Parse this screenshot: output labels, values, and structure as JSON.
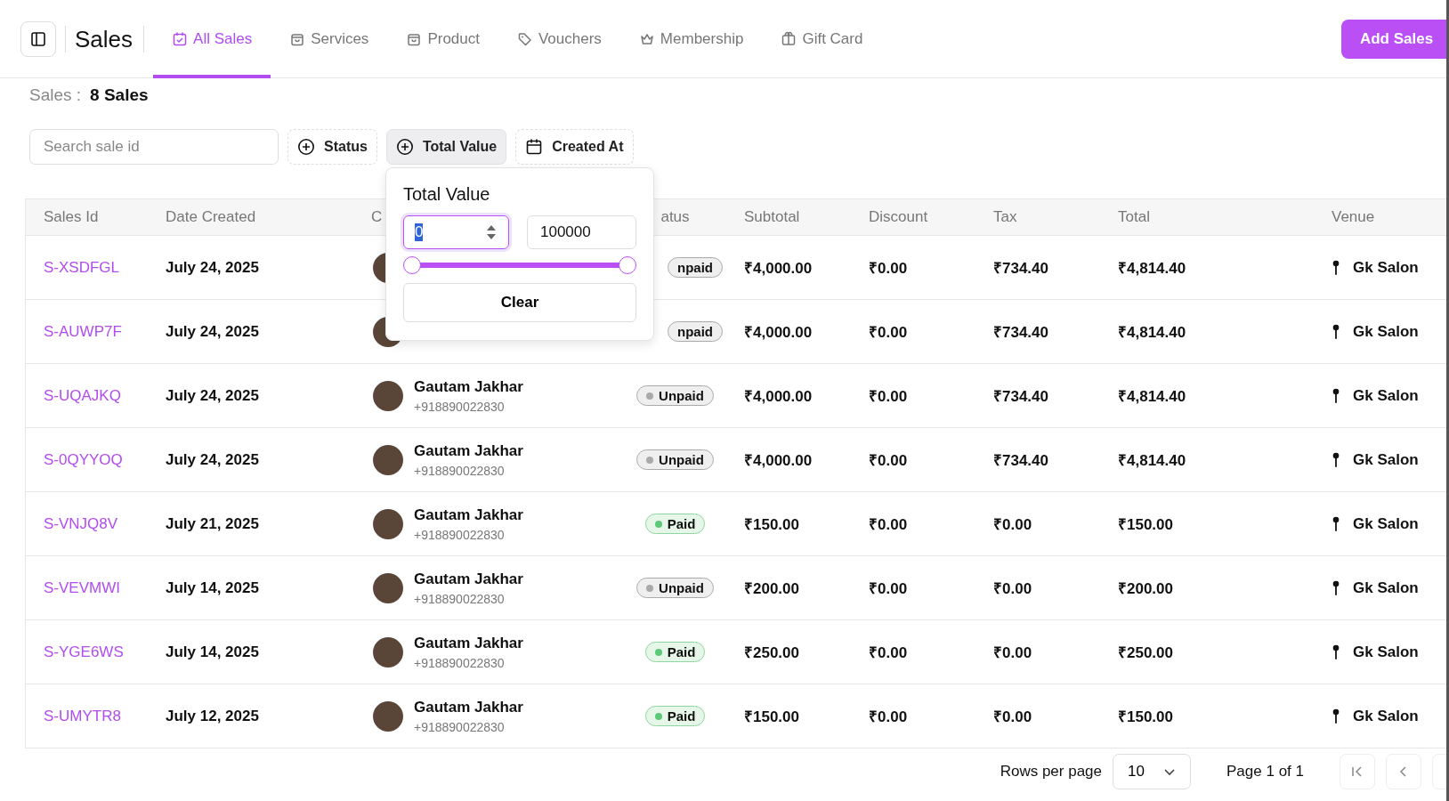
{
  "header": {
    "title": "Sales",
    "add_button": "Add Sales"
  },
  "tabs": [
    {
      "label": "All Sales",
      "selected": true
    },
    {
      "label": "Services",
      "selected": false
    },
    {
      "label": "Product",
      "selected": false
    },
    {
      "label": "Vouchers",
      "selected": false
    },
    {
      "label": "Membership",
      "selected": false
    },
    {
      "label": "Gift Card",
      "selected": false
    }
  ],
  "summary": {
    "label": "Sales :",
    "count": "8 Sales"
  },
  "filters": {
    "search": {
      "placeholder": "Search sale id"
    },
    "buttons": [
      {
        "label": "Status",
        "selected": false
      },
      {
        "label": "Total Value",
        "selected": true
      },
      {
        "label": "Created At",
        "selected": false
      }
    ]
  },
  "popover": {
    "title": "Total Value",
    "min": "0",
    "max": "100000",
    "thumbs": [
      {
        "level": 0
      },
      {
        "level": 1
      }
    ],
    "clear": "Clear"
  },
  "table": {
    "columns": [
      "Sales Id",
      "Date Created",
      "C",
      "atus",
      "Subtotal",
      "Discount",
      "Tax",
      "Total",
      "Venue"
    ],
    "rows": [
      {
        "id": "S-XSDFGL",
        "date": "July 24, 2025",
        "status": {
          "label": "npaid",
          "kind": "unpaid"
        },
        "subtotal": "₹4,000.00",
        "discount": "₹0.00",
        "tax": "₹734.40",
        "total": "₹4,814.40",
        "venue": "Gk Salon"
      },
      {
        "id": "S-AUWP7F",
        "date": "July 24, 2025",
        "status": {
          "label": "npaid",
          "kind": "unpaid"
        },
        "subtotal": "₹4,000.00",
        "discount": "₹0.00",
        "tax": "₹734.40",
        "total": "₹4,814.40",
        "venue": "Gk Salon"
      },
      {
        "id": "S-UQAJKQ",
        "date": "July 24, 2025",
        "customer": {
          "name": "Gautam Jakhar",
          "phone": "+918890022830"
        },
        "status": {
          "label": "Unpaid",
          "kind": "unpaid"
        },
        "subtotal": "₹4,000.00",
        "discount": "₹0.00",
        "tax": "₹734.40",
        "total": "₹4,814.40",
        "venue": "Gk Salon"
      },
      {
        "id": "S-0QYYOQ",
        "date": "July 24, 2025",
        "customer": {
          "name": "Gautam Jakhar",
          "phone": "+918890022830"
        },
        "status": {
          "label": "Unpaid",
          "kind": "unpaid"
        },
        "subtotal": "₹4,000.00",
        "discount": "₹0.00",
        "tax": "₹734.40",
        "total": "₹4,814.40",
        "venue": "Gk Salon"
      },
      {
        "id": "S-VNJQ8V",
        "date": "July 21, 2025",
        "customer": {
          "name": "Gautam Jakhar",
          "phone": "+918890022830"
        },
        "status": {
          "label": "Paid",
          "kind": "paid"
        },
        "subtotal": "₹150.00",
        "discount": "₹0.00",
        "tax": "₹0.00",
        "total": "₹150.00",
        "venue": "Gk Salon"
      },
      {
        "id": "S-VEVMWI",
        "date": "July 14, 2025",
        "customer": {
          "name": "Gautam Jakhar",
          "phone": "+918890022830"
        },
        "status": {
          "label": "Unpaid",
          "kind": "unpaid"
        },
        "subtotal": "₹200.00",
        "discount": "₹0.00",
        "tax": "₹0.00",
        "total": "₹200.00",
        "venue": "Gk Salon"
      },
      {
        "id": "S-YGE6WS",
        "date": "July 14, 2025",
        "customer": {
          "name": "Gautam Jakhar",
          "phone": "+918890022830"
        },
        "status": {
          "label": "Paid",
          "kind": "paid"
        },
        "subtotal": "₹250.00",
        "discount": "₹0.00",
        "tax": "₹0.00",
        "total": "₹250.00",
        "venue": "Gk Salon"
      },
      {
        "id": "S-UMYTR8",
        "date": "July 12, 2025",
        "customer": {
          "name": "Gautam Jakhar",
          "phone": "+918890022830"
        },
        "status": {
          "label": "Paid",
          "kind": "paid"
        },
        "subtotal": "₹150.00",
        "discount": "₹0.00",
        "tax": "₹0.00",
        "total": "₹150.00",
        "venue": "Gk Salon"
      }
    ]
  },
  "pagination": {
    "rows_label": "Rows per page",
    "rows_value": "10",
    "page_label": "Page 1 of 1"
  }
}
